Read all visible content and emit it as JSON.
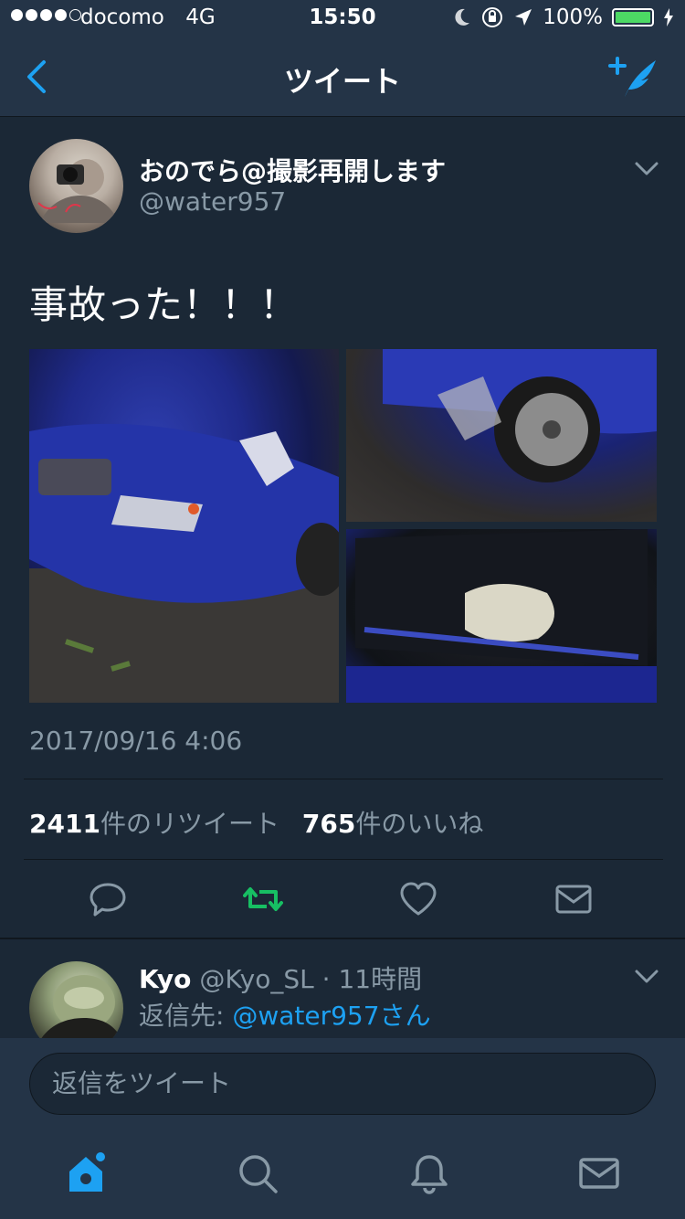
{
  "status_bar": {
    "carrier": "docomo",
    "network": "4G",
    "time": "15:50",
    "battery_percent": "100%",
    "battery_level": 1.0,
    "signal_bars": 4
  },
  "nav": {
    "title": "ツイート",
    "back_icon": "back-chevron-icon",
    "compose_icon": "compose-tweet-icon"
  },
  "tweet": {
    "display_name": "おのでら@撮影再開します",
    "handle": "@water957",
    "text": "事故った！！！",
    "timestamp": "2017/09/16 4:06",
    "retweet_count": "2411",
    "retweet_label": "件のリツイート",
    "like_count": "765",
    "like_label": "件のいいね",
    "media_count": 3
  },
  "reply": {
    "name": "Kyo",
    "handle": "@Kyo_SL",
    "time_sep": "·",
    "time": "11時間",
    "reply_to_label": "返信先: ",
    "reply_to_handle": "@water957さん"
  },
  "reply_input": {
    "placeholder": "返信をツイート"
  },
  "colors": {
    "background": "#1b2836",
    "bar": "#243447",
    "accent": "#1da1f2",
    "retweet": "#17bf63",
    "muted": "#8899a6"
  }
}
